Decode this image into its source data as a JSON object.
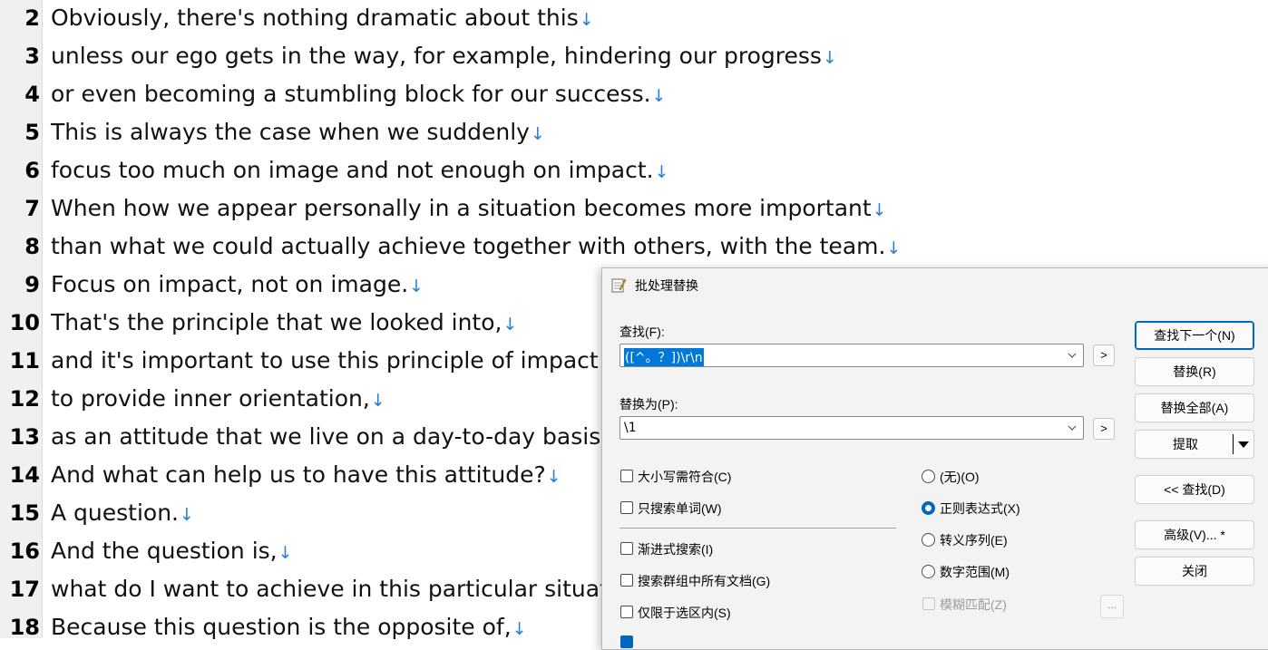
{
  "editor": {
    "eol_icon": "line-feed-arrow-icon",
    "lines": [
      {
        "n": "2",
        "text": "Obviously, there's nothing dramatic about this"
      },
      {
        "n": "3",
        "text": "unless our ego gets in the way, for example, hindering our progress"
      },
      {
        "n": "4",
        "text": "or even becoming a stumbling block for our success."
      },
      {
        "n": "5",
        "text": "This is always the case when we suddenly"
      },
      {
        "n": "6",
        "text": "focus too much on image and not enough on impact."
      },
      {
        "n": "7",
        "text": "When how we appear personally in a situation becomes more important"
      },
      {
        "n": "8",
        "text": "than what we could actually achieve together with others, with the team."
      },
      {
        "n": "9",
        "text": "Focus on impact, not on image."
      },
      {
        "n": "10",
        "text": "That's the principle that we looked into,"
      },
      {
        "n": "11",
        "text": "and it's important to use this principle of impact"
      },
      {
        "n": "12",
        "text": "to provide inner orientation,"
      },
      {
        "n": "13",
        "text": "as an attitude that we live on a day-to-day basis."
      },
      {
        "n": "14",
        "text": "And what can help us to have this attitude?"
      },
      {
        "n": "15",
        "text": "A question."
      },
      {
        "n": "16",
        "text": "And the question is,"
      },
      {
        "n": "17",
        "text": "what do I want to achieve in this particular situati"
      },
      {
        "n": "18",
        "text": "Because this question is the opposite of,"
      }
    ]
  },
  "dialog": {
    "title": "批处理替换",
    "title_icon": "notepad-pencil-icon",
    "find_label": "查找(F):",
    "find_value": "([^。？])\\r\\n",
    "replace_label": "替换为(P):",
    "replace_value": "\\1",
    "expand_button": ">",
    "buttons": {
      "find_next": "查找下一个(N)",
      "replace": "替换(R)",
      "replace_all": "替换全部(A)",
      "extract": "提取",
      "find_back": "<< 查找(D)",
      "advanced": "高级(V)... *",
      "close": "关闭"
    },
    "checkboxes": {
      "match_case": "大小写需符合(C)",
      "whole_word": "只搜索单词(W)",
      "incremental": "渐进式搜索(I)",
      "all_docs_in_group": "搜索群组中所有文档(G)",
      "selection_only": "仅限于选区内(S)",
      "fuzzy": "模糊匹配(Z)"
    },
    "search_mode": {
      "selected": "regex",
      "none": "(无)(O)",
      "regex": "正则表达式(X)",
      "escape": "转义序列(E)",
      "number_range": "数字范围(M)"
    },
    "fuzzy_options_button": "...",
    "accent_color": "#0067c0"
  }
}
